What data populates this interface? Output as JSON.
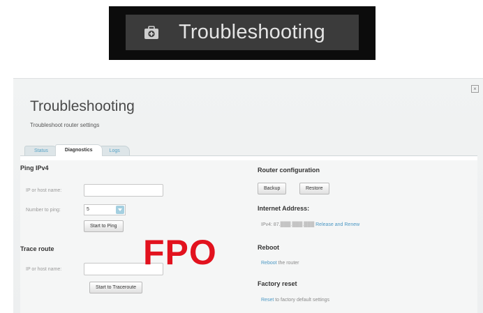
{
  "nav": {
    "title": "Troubleshooting",
    "icon": "toolbox-icon"
  },
  "page": {
    "title": "Troubleshooting",
    "subtitle": "Troubleshoot router settings",
    "close_icon": "close-icon"
  },
  "tabs": [
    {
      "label": "Status",
      "active": false
    },
    {
      "label": "Diagnostics",
      "active": true
    },
    {
      "label": "Logs",
      "active": false
    }
  ],
  "ping": {
    "heading": "Ping IPv4",
    "host_label": "IP or host name:",
    "host_value": "",
    "count_label": "Number to ping:",
    "count_value": "5",
    "button": "Start to Ping"
  },
  "trace": {
    "heading": "Trace route",
    "host_label": "IP or host name:",
    "host_value": "",
    "button": "Start to Traceroute"
  },
  "router_config": {
    "heading": "Router configuration",
    "backup": "Backup",
    "restore": "Restore"
  },
  "internet": {
    "heading": "Internet Address:",
    "ipv4_label": "IPv4: 87.",
    "ipv4_masked": "███.███.███",
    "link": "Release and Renew"
  },
  "reboot": {
    "heading": "Reboot",
    "link": "Reboot",
    "text": " the router"
  },
  "factory": {
    "heading": "Factory reset",
    "link": "Reset",
    "text": " to factory default settings"
  },
  "overlay": {
    "text": "FPO",
    "color": "#e2121e"
  },
  "colors": {
    "link": "#4c98c4",
    "nav_bg": "#0c0c0c",
    "nav_button": "#3b3b3b"
  }
}
